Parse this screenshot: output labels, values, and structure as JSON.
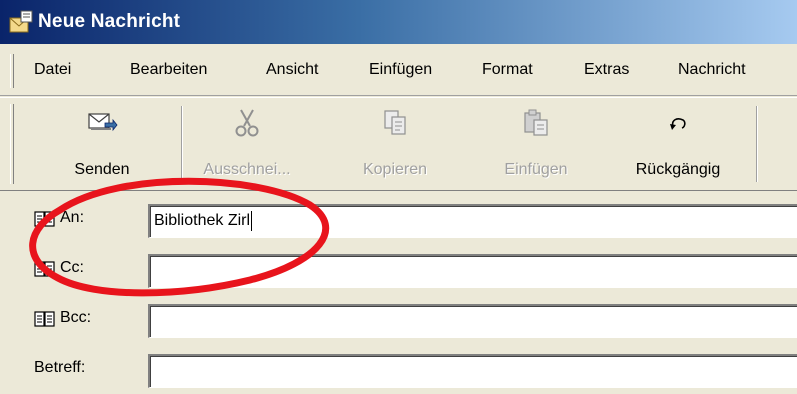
{
  "window": {
    "title": "Neue Nachricht"
  },
  "menu": {
    "items": [
      {
        "label": "Datei"
      },
      {
        "label": "Bearbeiten"
      },
      {
        "label": "Ansicht"
      },
      {
        "label": "Einfügen"
      },
      {
        "label": "Format"
      },
      {
        "label": "Extras"
      },
      {
        "label": "Nachricht"
      }
    ]
  },
  "toolbar": {
    "send_label": "Senden",
    "cut_label": "Ausschnei...",
    "copy_label": "Kopieren",
    "paste_label": "Einfügen",
    "undo_label": "Rückgängig"
  },
  "fields": {
    "to_label": "An:",
    "to_value": "Bibliothek Zirl",
    "cc_label": "Cc:",
    "cc_value": "",
    "bcc_label": "Bcc:",
    "bcc_value": "",
    "subject_label": "Betreff:",
    "subject_value": ""
  },
  "annotation": {
    "color": "#e8141c"
  }
}
